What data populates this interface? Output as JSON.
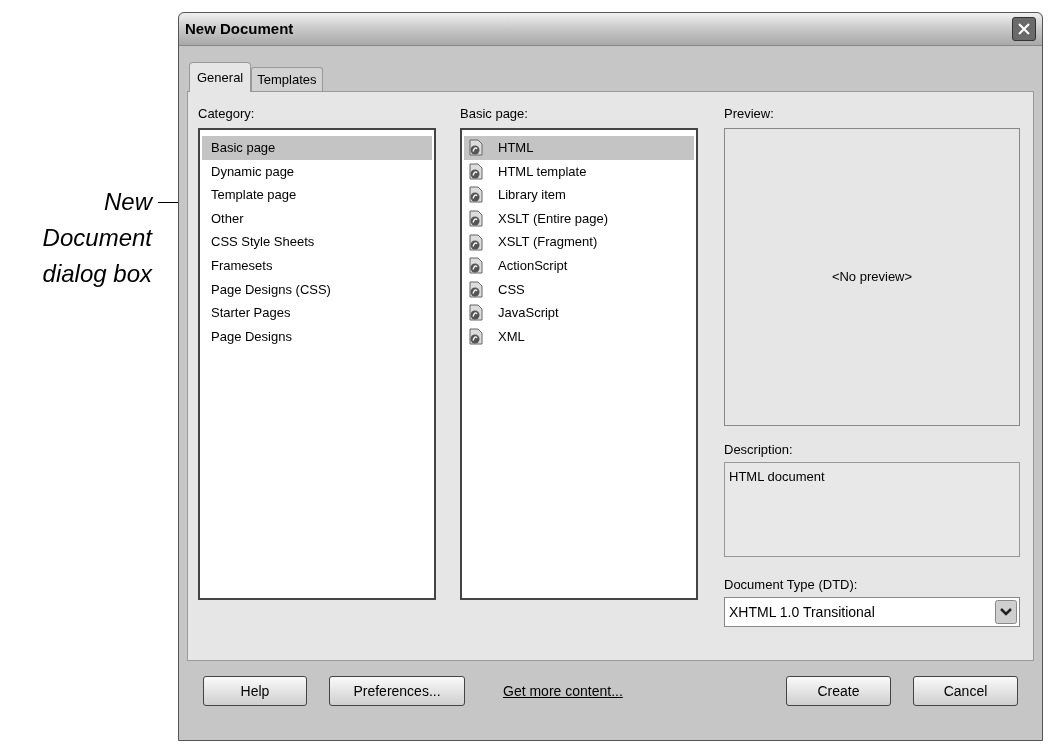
{
  "annotation": {
    "text": "New Document dialog box"
  },
  "window": {
    "title": "New Document"
  },
  "tabs": [
    {
      "label": "General",
      "selected": true
    },
    {
      "label": "Templates",
      "selected": false
    }
  ],
  "category": {
    "label": "Category:",
    "items": [
      {
        "label": "Basic page",
        "selected": true
      },
      {
        "label": "Dynamic page",
        "selected": false
      },
      {
        "label": "Template page",
        "selected": false
      },
      {
        "label": "Other",
        "selected": false
      },
      {
        "label": "CSS Style Sheets",
        "selected": false
      },
      {
        "label": "Framesets",
        "selected": false
      },
      {
        "label": "Page Designs (CSS)",
        "selected": false
      },
      {
        "label": "Starter Pages",
        "selected": false
      },
      {
        "label": "Page Designs",
        "selected": false
      }
    ]
  },
  "basic_page": {
    "label": "Basic page:",
    "items": [
      {
        "label": "HTML",
        "selected": true
      },
      {
        "label": "HTML template",
        "selected": false
      },
      {
        "label": "Library item",
        "selected": false
      },
      {
        "label": "XSLT (Entire page)",
        "selected": false
      },
      {
        "label": "XSLT (Fragment)",
        "selected": false
      },
      {
        "label": "ActionScript",
        "selected": false
      },
      {
        "label": "CSS",
        "selected": false
      },
      {
        "label": "JavaScript",
        "selected": false
      },
      {
        "label": "XML",
        "selected": false
      }
    ]
  },
  "preview": {
    "label": "Preview:",
    "text": "<No preview>"
  },
  "description": {
    "label": "Description:",
    "text": "HTML document"
  },
  "document_type": {
    "label": "Document Type (DTD):",
    "value": "XHTML 1.0 Transitional"
  },
  "footer": {
    "left_buttons": [
      "Help",
      "Preferences..."
    ],
    "link": "Get more content...",
    "right_buttons": [
      "Create",
      "Cancel"
    ]
  }
}
